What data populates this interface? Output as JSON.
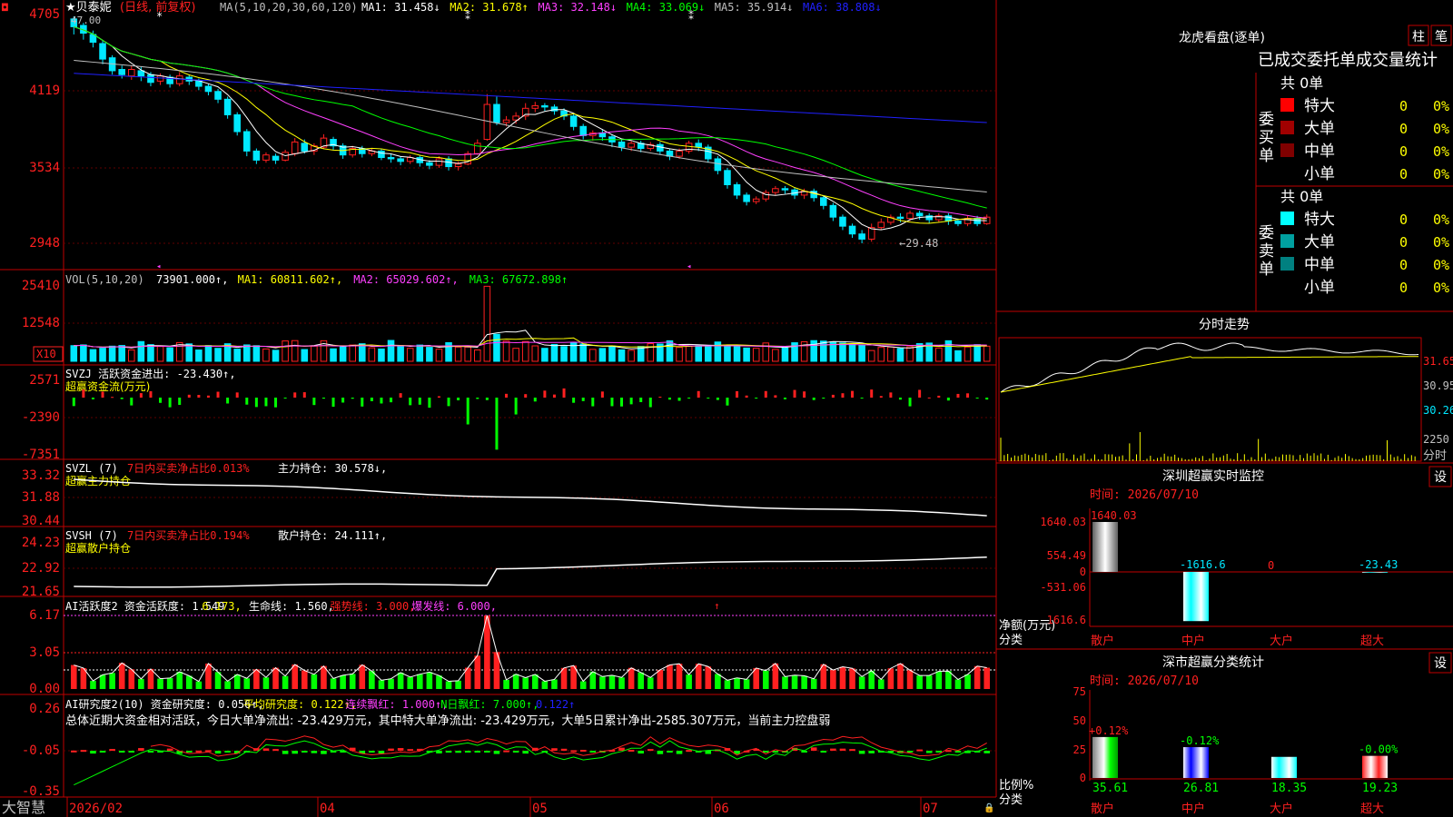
{
  "app": {
    "name": "大智慧"
  },
  "stock": {
    "name": "★贝泰妮",
    "mode": "(日线, 前复权)"
  },
  "colors": {
    "up": "#ff2020",
    "down": "#00e8ff",
    "ma1": "#ffffff",
    "ma2": "#ffff00",
    "ma3": "#ff40ff",
    "ma4": "#00ff00",
    "ma5": "#c0c0c0",
    "ma6": "#2020ff",
    "grid": "#c00000",
    "green": "#00ff00",
    "yellow": "#ffff00",
    "magenta": "#ff40ff"
  },
  "main_panel": {
    "ma_header": "MA(5,10,20,30,60,120)",
    "ma_labels": [
      {
        "text": "MA1: 31.458↓",
        "color": "#ffffff"
      },
      {
        "text": "MA2: 31.678↑",
        "color": "#ffff00"
      },
      {
        "text": "MA3: 32.148↓",
        "color": "#ff40ff"
      },
      {
        "text": "MA4: 33.069↓",
        "color": "#00ff00"
      },
      {
        "text": "MA5: 35.914↓",
        "color": "#c0c0c0"
      },
      {
        "text": "MA6: 38.808↓",
        "color": "#2020ff"
      }
    ],
    "y_ticks": [
      "4705",
      "4119",
      "3534",
      "2948"
    ],
    "high_label": "47.00",
    "low_label": "←29.48"
  },
  "vol_panel": {
    "header": "VOL(5,10,20)",
    "labels": [
      {
        "text": "73901.000↑,",
        "color": "#ffffff"
      },
      {
        "text": "MA1: 60811.602↑,",
        "color": "#ffff00"
      },
      {
        "text": "MA2: 65029.602↑,",
        "color": "#ff40ff"
      },
      {
        "text": "MA3: 67672.898↑",
        "color": "#00ff00"
      }
    ],
    "y_ticks": [
      "25410",
      "12548"
    ],
    "unit": "X10"
  },
  "svzj_panel": {
    "line1": "SVZJ  活跃资金进出: -23.430↑,",
    "line2": "超赢资金流(万元)",
    "y_ticks": [
      "2571",
      "-2390",
      "-7351"
    ]
  },
  "svzl_panel": {
    "line1a": "SVZL (7)",
    "line1b": "7日内买卖净占比0.013%",
    "line1c": "主力持仓: 30.578↓,",
    "line2": "超赢主力持仓",
    "y_ticks": [
      "33.32",
      "31.88",
      "30.44"
    ]
  },
  "svsh_panel": {
    "line1a": "SVSH (7)",
    "line1b": "7日内买卖净占比0.194%",
    "line1c": "散户持仓: 24.111↑,",
    "line2": "超赢散户持仓",
    "y_ticks": [
      "24.23",
      "22.92",
      "21.65"
    ]
  },
  "ai_active_panel": {
    "labels": [
      {
        "text": "AI活跃度2 资金活跃度: 1.549",
        "color": "#ffffff"
      },
      {
        "text": "6.173,",
        "color": "#ffff00"
      },
      {
        "text": "生命线: 1.560,",
        "color": "#ffffff"
      },
      {
        "text": "强势线: 3.000,",
        "color": "#ff2020"
      },
      {
        "text": "爆发线: 6.000,",
        "color": "#ff40ff"
      }
    ],
    "y_ticks": [
      "6.17",
      "3.05",
      "0.00"
    ]
  },
  "ai_research_panel": {
    "labels": [
      {
        "text": "AI研究度2(10) 资金研究度: 0.056↑,",
        "color": "#ffffff"
      },
      {
        "text": "平均研究度: 0.122↑,",
        "color": "#ffff00"
      },
      {
        "text": "连续飘红: 1.000↑,",
        "color": "#ff40ff"
      },
      {
        "text": "N日飘红: 7.000↑,",
        "color": "#00ff00"
      },
      {
        "text": "0.122↑",
        "color": "#2020ff"
      }
    ],
    "summary": "总体近期大资金相对活跃，今日大单净流出: -23.429万元，其中特大单净流出: -23.429万元，大单5日累计净出-2585.307万元，当前主力控盘弱",
    "y_ticks": [
      "0.26",
      "-0.05",
      "-0.35"
    ]
  },
  "x_axis": {
    "labels": [
      "2026/02",
      "04",
      "05",
      "06",
      "07"
    ]
  },
  "dragon_tiger": {
    "title": "龙虎看盘(逐单)",
    "btn_bar": "柱",
    "btn_pen": "笔",
    "subtitle": "已成交委托单成交量统计",
    "buy_group": {
      "side_label": "委买单",
      "total": "共 0单",
      "rows": [
        {
          "name": "特大",
          "count": "0",
          "pct": "0%",
          "color": "#ff0000"
        },
        {
          "name": "大单",
          "count": "0",
          "pct": "0%",
          "color": "#a00000"
        },
        {
          "name": "中单",
          "count": "0",
          "pct": "0%",
          "color": "#800000"
        },
        {
          "name": "小单",
          "count": "0",
          "pct": "0%",
          "color": ""
        }
      ]
    },
    "sell_group": {
      "side_label": "委卖单",
      "total": "共 0单",
      "rows": [
        {
          "name": "特大",
          "count": "0",
          "pct": "0%",
          "color": "#00ffff"
        },
        {
          "name": "大单",
          "count": "0",
          "pct": "0%",
          "color": "#00a0a0"
        },
        {
          "name": "中单",
          "count": "0",
          "pct": "0%",
          "color": "#008080"
        },
        {
          "name": "小单",
          "count": "0",
          "pct": "0%",
          "color": ""
        }
      ]
    }
  },
  "intraday": {
    "title": "分时走势",
    "y_ticks": [
      "31.65",
      "30.95",
      "30.26"
    ],
    "vol_tick": "2250",
    "vol_label": "分时"
  },
  "sz_monitor": {
    "title": "深圳超赢实时监控",
    "settings": "设",
    "time_label": "时间: 2026/07/10",
    "y_ticks": [
      "1640.03",
      "554.49",
      "0",
      "-531.06",
      "-1616.6"
    ],
    "ylabel1": "净额(万元)",
    "ylabel2": "分类",
    "categories": [
      "散户",
      "中户",
      "大户",
      "超大"
    ],
    "bar_labels": [
      "1640.03",
      "-1616.6",
      "0",
      "-23.43"
    ]
  },
  "sz_class": {
    "title": "深市超赢分类统计",
    "settings": "设",
    "time_label": "时间: 2026/07/10",
    "y_ticks": [
      "75",
      "50",
      "25",
      "0"
    ],
    "ylabel1": "比例%",
    "ylabel2": "分类",
    "categories": [
      "散户",
      "中户",
      "大户",
      "超大"
    ],
    "top_labels": [
      "+0.12%",
      "-0.12%",
      "",
      "-0.00%"
    ],
    "bottom_labels": [
      "35.61",
      "26.81",
      "18.35",
      "19.23"
    ]
  },
  "chart_data": {
    "type": "candlestick",
    "title": "贝泰妮 (日线, 前复权)",
    "x_labels": [
      "2026/02",
      "04",
      "05",
      "06",
      "07"
    ],
    "price_range": [
      29.48,
      47.0
    ],
    "price": [
      [
        46.8,
        46.2,
        47.0,
        45.6
      ],
      [
        46.3,
        45.7,
        46.5,
        45.2
      ],
      [
        45.6,
        45.0,
        45.9,
        44.6
      ],
      [
        44.9,
        43.7,
        45.1,
        43.3
      ],
      [
        43.8,
        42.8,
        44.0,
        42.5
      ],
      [
        42.9,
        42.5,
        43.2,
        42.2
      ],
      [
        42.4,
        42.9,
        43.2,
        42.1
      ],
      [
        42.8,
        42.4,
        43.1,
        42.0
      ],
      [
        42.5,
        41.9,
        42.7,
        41.6
      ],
      [
        42.0,
        42.4,
        42.6,
        41.7
      ],
      [
        42.3,
        41.8,
        42.5,
        41.5
      ],
      [
        41.8,
        42.4,
        42.7,
        41.6
      ],
      [
        42.3,
        42.0,
        42.5,
        41.7
      ],
      [
        42.0,
        41.6,
        42.2,
        41.3
      ],
      [
        41.6,
        41.2,
        41.8,
        40.9
      ],
      [
        41.2,
        40.6,
        41.4,
        40.3
      ],
      [
        40.6,
        39.4,
        40.8,
        39.1
      ],
      [
        39.4,
        38.1,
        39.6,
        37.8
      ],
      [
        38.1,
        36.6,
        38.3,
        36.2
      ],
      [
        36.6,
        35.9,
        36.8,
        35.6
      ],
      [
        35.9,
        36.3,
        36.5,
        35.7
      ],
      [
        36.2,
        35.9,
        36.4,
        35.6
      ],
      [
        35.9,
        36.5,
        36.7,
        35.8
      ],
      [
        36.4,
        37.3,
        37.6,
        36.2
      ],
      [
        37.2,
        36.6,
        37.5,
        36.4
      ],
      [
        36.6,
        37.0,
        37.2,
        36.3
      ],
      [
        36.9,
        37.6,
        37.9,
        36.8
      ],
      [
        37.5,
        37.0,
        37.7,
        36.7
      ],
      [
        37.0,
        36.3,
        37.2,
        36.0
      ],
      [
        36.3,
        36.8,
        37.0,
        36.1
      ],
      [
        36.8,
        36.4,
        37.0,
        36.1
      ],
      [
        36.4,
        36.6,
        36.8,
        36.2
      ],
      [
        36.6,
        36.1,
        36.8,
        35.9
      ],
      [
        36.1,
        36.0,
        36.4,
        35.7
      ],
      [
        36.0,
        35.8,
        36.2,
        35.5
      ],
      [
        35.8,
        36.1,
        36.3,
        35.6
      ],
      [
        36.1,
        35.7,
        36.3,
        35.4
      ],
      [
        35.7,
        35.5,
        35.9,
        35.2
      ],
      [
        35.5,
        36.0,
        36.2,
        35.3
      ],
      [
        36.0,
        35.4,
        36.2,
        35.1
      ],
      [
        35.4,
        35.6,
        35.8,
        35.1
      ],
      [
        35.6,
        36.4,
        36.6,
        35.5
      ],
      [
        36.4,
        37.2,
        37.5,
        36.3
      ],
      [
        37.5,
        40.2,
        41.0,
        37.4
      ],
      [
        40.2,
        38.8,
        40.8,
        38.6
      ],
      [
        38.8,
        39.0,
        39.3,
        38.5
      ],
      [
        39.0,
        39.3,
        39.6,
        38.7
      ],
      [
        39.3,
        39.9,
        40.3,
        39.0
      ],
      [
        39.9,
        40.1,
        40.4,
        39.6
      ],
      [
        40.1,
        40.0,
        40.3,
        39.7
      ],
      [
        40.0,
        39.7,
        40.2,
        39.4
      ],
      [
        39.7,
        39.3,
        39.9,
        39.0
      ],
      [
        39.3,
        38.5,
        39.5,
        38.2
      ],
      [
        38.5,
        37.8,
        38.7,
        37.5
      ],
      [
        37.8,
        38.0,
        38.2,
        37.4
      ],
      [
        38.0,
        37.7,
        38.3,
        37.4
      ],
      [
        37.7,
        37.3,
        37.9,
        36.9
      ],
      [
        37.3,
        36.9,
        37.5,
        36.6
      ],
      [
        36.9,
        37.2,
        37.4,
        36.6
      ],
      [
        37.2,
        36.8,
        37.4,
        36.5
      ],
      [
        36.8,
        37.1,
        37.3,
        36.6
      ],
      [
        37.1,
        36.6,
        37.3,
        36.3
      ],
      [
        36.6,
        36.2,
        36.8,
        35.9
      ],
      [
        36.2,
        36.6,
        36.8,
        36.0
      ],
      [
        36.6,
        37.2,
        37.4,
        36.4
      ],
      [
        37.2,
        36.9,
        37.5,
        36.6
      ],
      [
        36.9,
        36.0,
        37.1,
        35.7
      ],
      [
        36.0,
        35.1,
        36.2,
        34.8
      ],
      [
        35.1,
        34.0,
        35.3,
        33.7
      ],
      [
        34.0,
        33.2,
        34.2,
        32.9
      ],
      [
        33.2,
        32.7,
        33.4,
        32.4
      ],
      [
        32.7,
        32.9,
        33.1,
        32.5
      ],
      [
        32.9,
        33.4,
        33.6,
        32.7
      ],
      [
        33.4,
        33.7,
        33.9,
        33.2
      ],
      [
        33.7,
        33.6,
        33.9,
        33.3
      ],
      [
        33.6,
        33.2,
        33.8,
        32.9
      ],
      [
        33.2,
        33.5,
        33.7,
        32.9
      ],
      [
        33.5,
        33.0,
        33.7,
        32.7
      ],
      [
        33.0,
        32.4,
        33.2,
        32.1
      ],
      [
        32.4,
        31.5,
        32.6,
        31.2
      ],
      [
        31.5,
        30.8,
        31.7,
        30.5
      ],
      [
        30.8,
        30.2,
        31.0,
        29.9
      ],
      [
        30.2,
        29.8,
        30.5,
        29.48
      ],
      [
        29.8,
        30.7,
        31.0,
        29.6
      ],
      [
        30.7,
        31.1,
        31.4,
        30.5
      ],
      [
        31.1,
        31.5,
        31.7,
        30.9
      ],
      [
        31.5,
        31.4,
        31.8,
        31.1
      ],
      [
        31.4,
        31.8,
        32.0,
        31.2
      ],
      [
        31.8,
        31.6,
        32.0,
        31.3
      ],
      [
        31.6,
        31.3,
        31.8,
        31.0
      ],
      [
        31.3,
        31.6,
        31.8,
        31.1
      ],
      [
        31.6,
        31.2,
        31.8,
        30.9
      ],
      [
        31.2,
        31.0,
        31.4,
        30.8
      ],
      [
        31.0,
        31.4,
        31.6,
        30.8
      ],
      [
        31.4,
        31.0,
        31.6,
        30.8
      ],
      [
        31.0,
        31.5,
        31.7,
        30.9
      ]
    ],
    "volume_range": [
      0,
      25410
    ],
    "svzj_range": [
      -7351,
      2571
    ],
    "svzl_range": [
      30.44,
      33.32
    ],
    "svsh_range": [
      21.65,
      24.23
    ],
    "ai_active_range": [
      0,
      6.17
    ],
    "ai_research_range": [
      -0.35,
      0.26
    ],
    "sz_monitor_values": [
      1640.03,
      -1616.6,
      0,
      -23.43
    ],
    "sz_class_values": [
      35.61,
      26.81,
      18.35,
      19.23
    ]
  }
}
